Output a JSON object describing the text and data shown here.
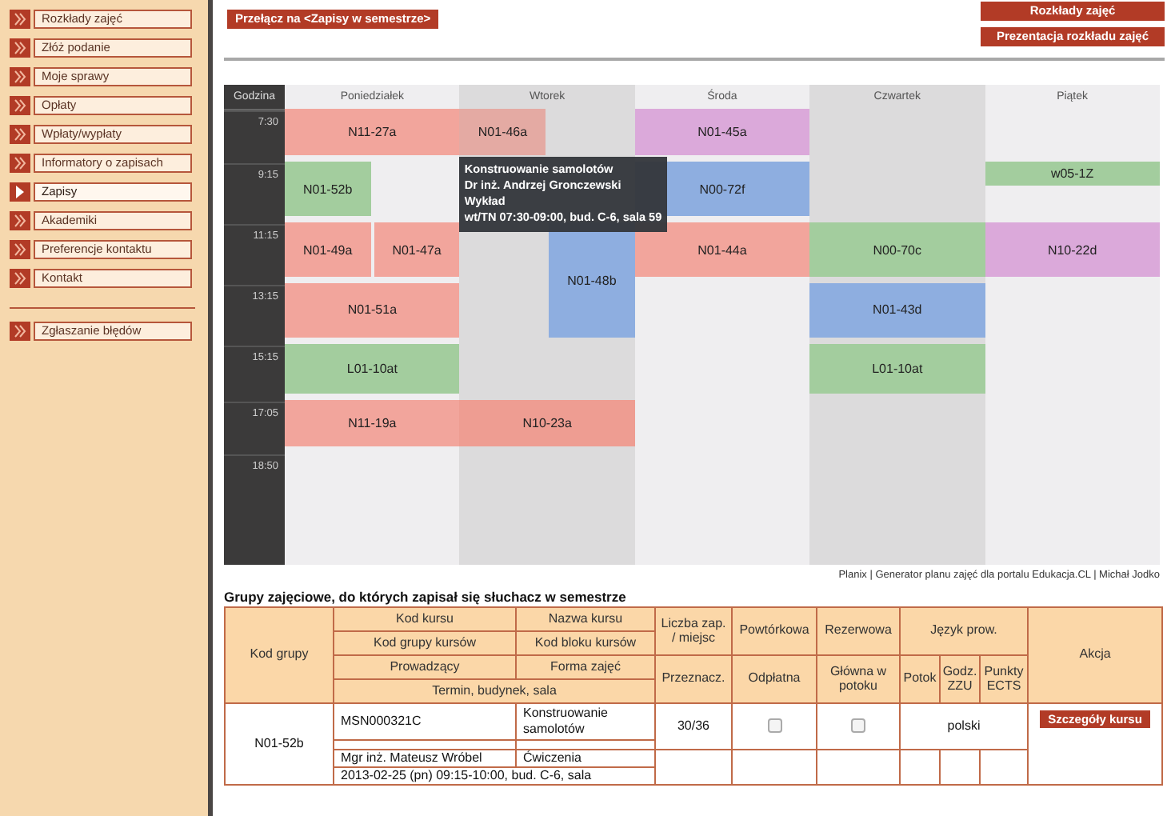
{
  "sidebar": {
    "items": [
      {
        "label": "Rozkłady zajęć",
        "selected": false
      },
      {
        "label": "Złóż podanie",
        "selected": false
      },
      {
        "label": "Moje sprawy",
        "selected": false
      },
      {
        "label": "Opłaty",
        "selected": false
      },
      {
        "label": "Wpłaty/wypłaty",
        "selected": false
      },
      {
        "label": "Informatory o zapisach",
        "selected": false
      },
      {
        "label": "Zapisy",
        "selected": true
      },
      {
        "label": "Akademiki",
        "selected": false
      },
      {
        "label": "Preferencje kontaktu",
        "selected": false
      },
      {
        "label": "Kontakt",
        "selected": false
      }
    ],
    "extra_items": [
      {
        "label": "Zgłaszanie błędów",
        "selected": false
      }
    ]
  },
  "toolbar": {
    "switch_button": "Przełącz na <Zapisy w semestrze>",
    "buttons": [
      "Rozkłady zajęć",
      "Prezentacja rozkładu zajęć"
    ]
  },
  "timetable": {
    "time_header": "Godzina",
    "days": [
      {
        "name": "Poniedziałek"
      },
      {
        "name": "Wtorek",
        "tooltip": {
          "title": "Konstruowanie samolotów",
          "lines": [
            "Dr inż. Andrzej Gronczewski",
            "Wykład",
            "wt/TN 07:30-09:00, bud. C-6, sala 59"
          ]
        }
      },
      {
        "name": "Środa"
      },
      {
        "name": "Czwartek"
      },
      {
        "name": "Piątek"
      }
    ],
    "rows": [
      {
        "time": "7:30",
        "cells": [
          [
            {
              "code": "N11-27a",
              "kind": "full",
              "color": "#f2a59c"
            }
          ],
          [
            {
              "code": "N01-46a",
              "kind": "left",
              "color": "#e4aaa3"
            }
          ],
          [
            {
              "code": "N01-45a",
              "kind": "full",
              "color": "#dba9da"
            }
          ],
          [],
          []
        ]
      },
      {
        "time": "9:15",
        "cells": [
          [
            {
              "code": "N01-52b",
              "kind": "left",
              "color": "#a3cd9e"
            }
          ],
          [],
          [
            {
              "code": "N00-72f",
              "kind": "full",
              "color": "#8eaee0"
            }
          ],
          [],
          [
            {
              "code": "w05-1Z",
              "kind": "short",
              "color": "#a3cd9e"
            }
          ]
        ]
      },
      {
        "time": "11:15",
        "cells": [
          [
            {
              "code": "N01-49a",
              "kind": "left",
              "color": "#f2a59c"
            },
            {
              "code": "N01-47a",
              "kind": "right",
              "color": "#f2a59c"
            }
          ],
          [
            {
              "code": "N01-48b",
              "kind": "tallright",
              "color": "#8eaee0"
            }
          ],
          [
            {
              "code": "N01-44a",
              "kind": "full",
              "color": "#f2a59c"
            }
          ],
          [
            {
              "code": "N00-70c",
              "kind": "full",
              "color": "#a3cd9e"
            }
          ],
          [
            {
              "code": "N10-22d",
              "kind": "full",
              "color": "#dba9da"
            }
          ]
        ]
      },
      {
        "time": "13:15",
        "cells": [
          [
            {
              "code": "N01-51a",
              "kind": "full",
              "color": "#f2a59c"
            }
          ],
          [],
          [],
          [
            {
              "code": "N01-43d",
              "kind": "full",
              "color": "#8eaee0"
            }
          ],
          []
        ]
      },
      {
        "time": "15:15",
        "cells": [
          [
            {
              "code": "L01-10at",
              "kind": "full",
              "color": "#a3cd9e"
            }
          ],
          [],
          [],
          [
            {
              "code": "L01-10at",
              "kind": "full",
              "color": "#a3cd9e"
            }
          ],
          []
        ]
      },
      {
        "time": "17:05",
        "cells": [
          [
            {
              "code": "N11-19a",
              "kind": "full",
              "color": "#f2a59c"
            }
          ],
          [
            {
              "code": "N10-23a",
              "kind": "full",
              "color": "#ee9d92"
            }
          ],
          [],
          [],
          []
        ]
      },
      {
        "time": "18:50",
        "cells": [
          [],
          [],
          [],
          [],
          []
        ]
      }
    ]
  },
  "credits": "Planix | Generator planu zajęć dla portalu Edukacja.CL | Michał Jodko",
  "groups_table": {
    "title": "Grupy zajęciowe, do których zapisał się słuchacz w semestrze",
    "header": {
      "group_code": "Kod grupy",
      "course_code": "Kod kursu",
      "course_name": "Nazwa kursu",
      "course_group_code": "Kod grupy kursów",
      "course_block_code": "Kod bloku kursów",
      "lecturer": "Prowadzący",
      "form": "Forma zajęć",
      "schedule": "Termin, budynek, sala",
      "enrolled": "Liczba zap. / miejsc",
      "intended": "Przeznacz.",
      "repeat": "Powtórkowa",
      "paid": "Odpłatna",
      "reserve": "Rezerwowa",
      "main_in_stream": "Główna w potoku",
      "language": "Język prow.",
      "stream": "Potok",
      "zzu_hours": "Godz. ZZU",
      "ects": "Punkty ECTS",
      "action": "Akcja"
    },
    "rows": [
      {
        "group_code": "N01-52b",
        "course_code": "MSN000321C",
        "course_name": "Konstruowanie samolotów",
        "lecturer": "Mgr inż. Mateusz Wróbel",
        "form": "Ćwiczenia",
        "schedule": "2013-02-25 (pn) 09:15-10:00, bud. C-6, sala",
        "enrolled": "30/36",
        "repeat": false,
        "reserve": false,
        "language": "polski",
        "action": "Szczegóły kursu"
      }
    ]
  }
}
